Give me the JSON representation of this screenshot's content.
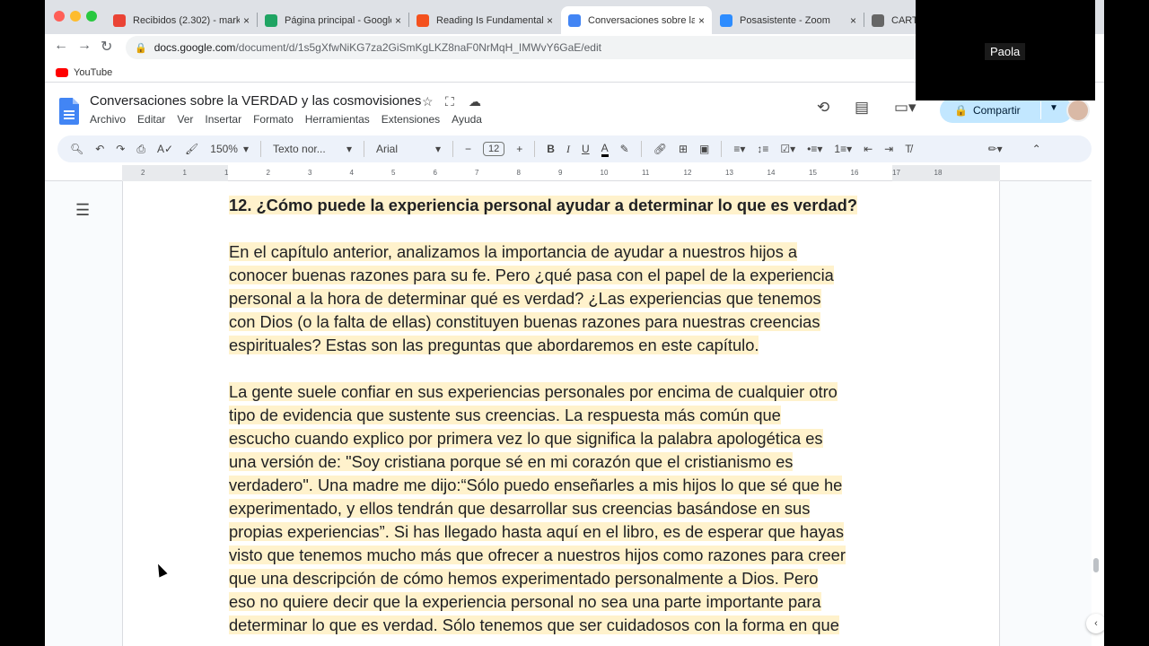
{
  "browser": {
    "tabs": [
      {
        "label": "Recibidos (2.302) - mark",
        "icon": "gmail-icon",
        "color": "#ea4335",
        "active": false
      },
      {
        "label": "Página principal - Google",
        "icon": "drive-icon",
        "color": "#1fa463",
        "active": false
      },
      {
        "label": "Reading Is Fundamental",
        "icon": "slides-icon",
        "color": "#f4511e",
        "active": false
      },
      {
        "label": "Conversaciones sobre la",
        "icon": "docs-icon",
        "color": "#4285f4",
        "active": true
      },
      {
        "label": "Posasistente - Zoom",
        "icon": "zoom-icon",
        "color": "#2d8cff",
        "active": false
      },
      {
        "label": "CARTA",
        "icon": "tool-icon",
        "color": "#666666",
        "active": false
      }
    ],
    "url_domain": "docs.google.com",
    "url_path": "/document/d/1s5gXfwNiKG7za2GiSmKgLKZ8naF0NrMqH_IMWvY6GaE/edit",
    "bookmark": "YouTube"
  },
  "docs": {
    "title": "Conversaciones sobre la VERDAD y las cosmovisiones",
    "menus": [
      "Archivo",
      "Editar",
      "Ver",
      "Insertar",
      "Formato",
      "Herramientas",
      "Extensiones",
      "Ayuda"
    ],
    "share_label": "Compartir",
    "toolbar": {
      "zoom": "150%",
      "style": "Texto nor...",
      "font": "Arial",
      "size": "12"
    },
    "ruler_marks": [
      "2",
      "1",
      "1",
      "2",
      "3",
      "4",
      "5",
      "6",
      "7",
      "8",
      "9",
      "10",
      "11",
      "12",
      "13",
      "14",
      "15",
      "16",
      "17",
      "18"
    ]
  },
  "content": {
    "heading": "12. ¿Cómo puede la experiencia personal ayudar a determinar lo que es verdad?",
    "para1_lines": [
      "En el capítulo anterior, analizamos la importancia de ayudar a nuestros hijos a",
      "conocer buenas razones para su fe. Pero ¿qué pasa con el papel de la experiencia",
      "personal a la hora de determinar qué es verdad? ¿Las experiencias que tenemos",
      "con Dios (o la falta de ellas) constituyen buenas razones para nuestras creencias",
      "espirituales? Estas son las preguntas que abordaremos en este capítulo."
    ],
    "para2_lines": [
      "La gente suele confiar en sus experiencias personales por encima de cualquier otro",
      "tipo de evidencia que sustente sus creencias. La respuesta más común que",
      "escucho cuando explico por primera vez lo que significa la palabra apologética es",
      "una versión de: \"Soy cristiana porque sé en mi corazón que el cristianismo es",
      "verdadero\". Una madre me dijo:“Sólo puedo enseñarles a mis hijos lo que sé que he",
      "experimentado, y ellos tendrán que desarrollar sus creencias basándose en sus",
      "propias experiencias”. Si has llegado hasta aquí en el libro, es de esperar que hayas",
      "visto que tenemos mucho más que ofrecer a nuestros hijos como razones para creer",
      "que una descripción de cómo hemos experimentado personalmente a Dios. Pero",
      "eso no quiere decir que la experiencia personal no sea una parte importante para",
      "determinar lo que es verdad. Sólo tenemos que ser cuidadosos con la forma en que"
    ]
  },
  "zoom_overlay": {
    "name": "Paola"
  }
}
